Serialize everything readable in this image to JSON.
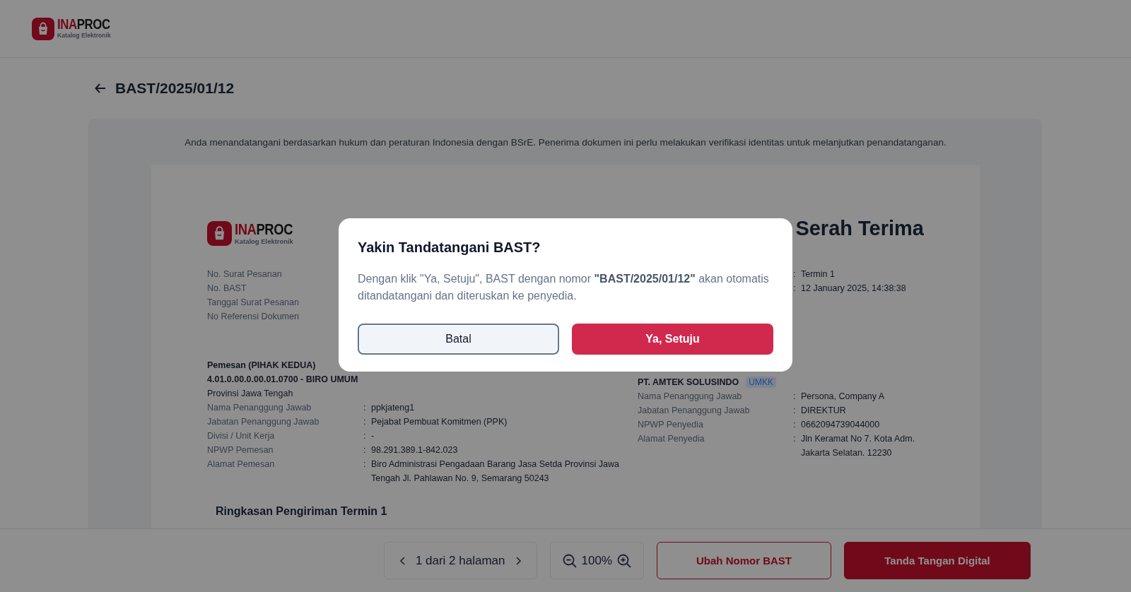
{
  "header": {
    "logo": {
      "brand_accent": "INA",
      "brand_main": "PROC",
      "tagline": "Katalog Elektronik"
    }
  },
  "page_title": "BAST/2025/01/12",
  "notice": "Anda menandatangani berdasarkan hukum dan peraturan Indonesia dengan BSrE. Penerima dokumen ini perlu melakukan verifikasi identitas untuk melanjutkan penandatanganan.",
  "document": {
    "logo": {
      "brand_accent": "INA",
      "brand_main": "PROC",
      "tagline": "Katalog Elektronik"
    },
    "title": "Serah Terima",
    "info_labels": [
      "No. Surat Pesanan",
      "No. BAST",
      "Tanggal Surat Pesanan",
      "No Referensi Dokumen"
    ],
    "info_values": [
      {
        "colon": ":",
        "value": "Termin 1"
      },
      {
        "colon": ":",
        "value": "12 January 2025, 14:38:38"
      }
    ],
    "buyer": {
      "heading": "Pemesan (PIHAK KEDUA)",
      "unit": "4.01.0.00.0.00.01.0700 - BIRO UMUM",
      "province": "Provinsi Jawa Tengah",
      "rows": [
        {
          "label": "Nama Penanggung Jawab",
          "colon": ":",
          "value": "ppkjateng1"
        },
        {
          "label": "Jabatan Penanggung Jawab",
          "colon": ":",
          "value": "Pejabat Pembuat Komitmen (PPK)"
        },
        {
          "label": "Divisi / Unit Kerja",
          "colon": ":",
          "value": "-"
        },
        {
          "label": "NPWP Pemesan",
          "colon": ":",
          "value": "98.291.389.1-842.023"
        },
        {
          "label": "Alamat Pemesan",
          "colon": ":",
          "value": "Biro Administrasi Pengadaan Barang Jasa Setda Provinsi Jawa Tengah Jl. Pahlawan No. 9, Semarang 50243"
        }
      ]
    },
    "seller": {
      "name": "PT. AMTEK SOLUSINDO",
      "badge": "UMKK",
      "rows": [
        {
          "label": "Nama Penanggung Jawab",
          "colon": ":",
          "value": "Persona, Company A"
        },
        {
          "label": "Jabatan Penanggung Jawab",
          "colon": ":",
          "value": "DIREKTUR"
        },
        {
          "label": "NPWP Penyedia",
          "colon": ":",
          "value": "0662094739044000"
        },
        {
          "label": "Alamat Penyedia",
          "colon": ":",
          "value": "Jln Keramat No 7. Kota Adm. Jakarta Selatan. 12230"
        }
      ]
    },
    "section_title": "Ringkasan Pengiriman Termin 1"
  },
  "toolbar": {
    "pagination": "1 dari 2 halaman",
    "zoom": "100%",
    "buttons": [
      {
        "label": "Ubah Nomor BAST",
        "kind": "outline"
      },
      {
        "label": "Tanda Tangan Digital",
        "kind": "primary"
      }
    ]
  },
  "dialog": {
    "title": "Yakin Tandatangani BAST?",
    "message": "Dengan klik \"Ya, Setuju\", BAST dengan nomor **\"BAST/2025/01/12\"** akan otomatis ditandatangani dan diteruskan ke penyedia.",
    "buttons": [
      {
        "label": "Batal",
        "kind": "secondary"
      },
      {
        "label": "Ya, Setuju",
        "kind": "primary"
      }
    ]
  }
}
